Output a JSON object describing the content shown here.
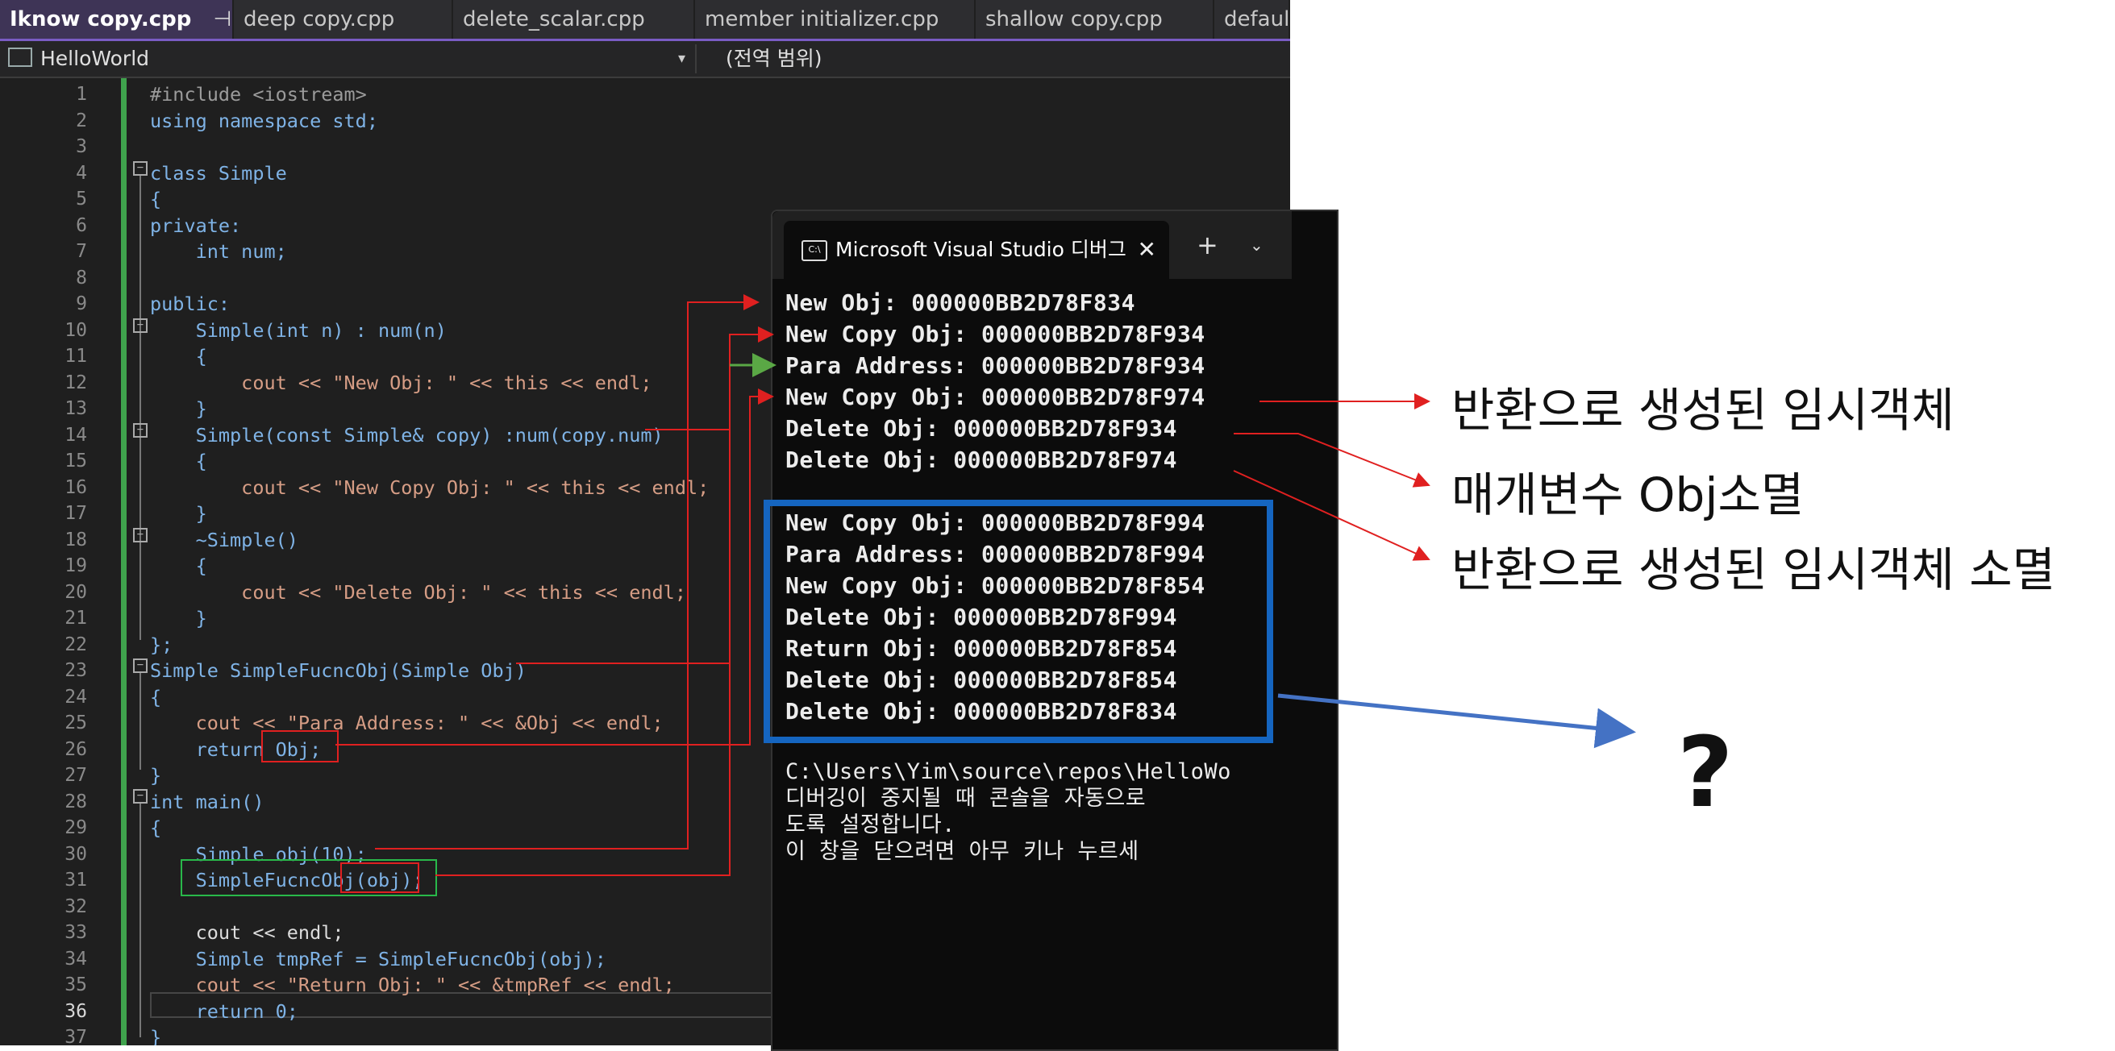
{
  "editor": {
    "tabs": [
      {
        "label": "Iknow copy.cpp",
        "active": true
      },
      {
        "label": "deep copy.cpp"
      },
      {
        "label": "delete_scalar.cpp"
      },
      {
        "label": "member initializer.cpp"
      },
      {
        "label": "shallow copy.cpp"
      },
      {
        "label": "default"
      }
    ],
    "tab_pin": "⊣",
    "tab_close": "✕",
    "nav_project": "HelloWorld",
    "nav_dropdown": "▾",
    "nav_scope": "(전역 범위)",
    "line_numbers": [
      "1",
      "2",
      "3",
      "4",
      "5",
      "6",
      "7",
      "8",
      "9",
      "10",
      "11",
      "12",
      "13",
      "14",
      "15",
      "16",
      "17",
      "18",
      "19",
      "20",
      "21",
      "22",
      "23",
      "24",
      "25",
      "26",
      "27",
      "28",
      "29",
      "30",
      "31",
      "32",
      "33",
      "34",
      "35",
      "36",
      "37"
    ],
    "current_line": "36",
    "code_lines": [
      "#include <iostream>",
      "using namespace std;",
      "",
      "class Simple",
      "{",
      "private:",
      "    int num;",
      "",
      "public:",
      "    Simple(int n) : num(n)",
      "    {",
      "        cout << \"New Obj: \" << this << endl;",
      "    }",
      "    Simple(const Simple& copy) :num(copy.num)",
      "    {",
      "        cout << \"New Copy Obj: \" << this << endl;",
      "    }",
      "    ~Simple()",
      "    {",
      "        cout << \"Delete Obj: \" << this << endl;",
      "    }",
      "};",
      "Simple SimpleFucncObj(Simple Obj)",
      "{",
      "    cout << \"Para Address: \" << &Obj << endl;",
      "    return Obj;",
      "}",
      "int main()",
      "{",
      "    Simple obj(10);",
      "    SimpleFucncObj(obj);",
      "",
      "    cout << endl;",
      "    Simple tmpRef = SimpleFucncObj(obj);",
      "    cout << \"Return Obj: \" << &tmpRef << endl;",
      "    return 0;",
      "}"
    ]
  },
  "console": {
    "title": "Microsoft Visual Studio 디버그",
    "icon": "C:\\",
    "close": "✕",
    "plus": "+",
    "dropdown": "⌄",
    "output_lines": [
      "New Obj: 000000BB2D78F834",
      "New Copy Obj: 000000BB2D78F934",
      "Para Address: 000000BB2D78F934",
      "New Copy Obj: 000000BB2D78F974",
      "Delete Obj: 000000BB2D78F934",
      "Delete Obj: 000000BB2D78F974",
      "",
      "New Copy Obj: 000000BB2D78F994",
      "Para Address: 000000BB2D78F994",
      "New Copy Obj: 000000BB2D78F854",
      "Delete Obj: 000000BB2D78F994",
      "Return Obj: 000000BB2D78F854",
      "Delete Obj: 000000BB2D78F854",
      "Delete Obj: 000000BB2D78F834",
      ""
    ],
    "footer_lines": [
      "C:\\Users\\Yim\\source\\repos\\HelloWo",
      "디버깅이 중지될 때 콘솔을 자동으로",
      "도록 설정합니다.",
      "이 창을 닫으려면 아무 키나 누르세"
    ]
  },
  "annotations": {
    "temp_object": "반환으로 생성된 임시객체",
    "param_destroyed": "매개변수 Obj소멸",
    "temp_destroyed": "반환으로 생성된 임시객체 소멸",
    "question": "?"
  },
  "colors": {
    "arrow_red": "#e02020",
    "arrow_green": "#5aa845",
    "highlight_blue": "#1565c0"
  }
}
